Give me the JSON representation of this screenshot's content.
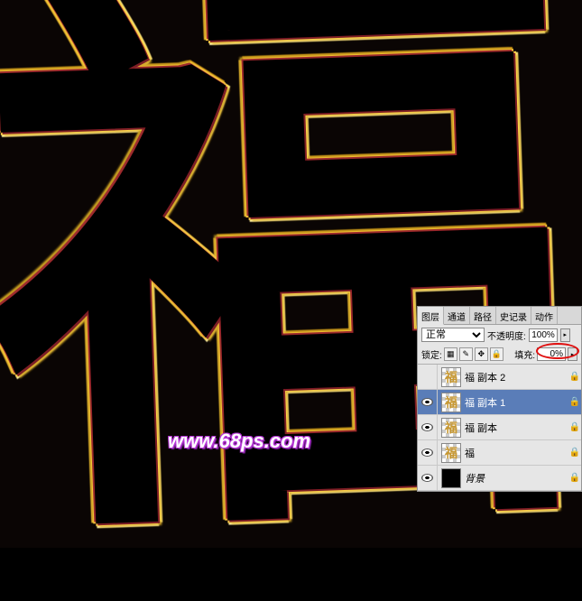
{
  "canvas": {
    "character": "福"
  },
  "watermark": "www.68ps.com",
  "panel": {
    "tabs": {
      "layers": "图层",
      "channels": "通道",
      "paths": "路径",
      "history": "史记录",
      "actions": "动作"
    },
    "blend_mode": "正常",
    "opacity_label": "不透明度:",
    "opacity_value": "100%",
    "lock_label": "锁定:",
    "fill_label": "填充:",
    "fill_value": "0%",
    "layers": [
      {
        "name": "福 副本 2",
        "visible": false,
        "thumb": "福",
        "locked": true
      },
      {
        "name": "福 副本 1",
        "visible": true,
        "thumb": "福",
        "locked": true,
        "selected": true
      },
      {
        "name": "福 副本",
        "visible": true,
        "thumb": "福",
        "locked": true
      },
      {
        "name": "福",
        "visible": true,
        "thumb": "福",
        "locked": true
      },
      {
        "name": "背景",
        "visible": true,
        "thumb": "",
        "locked": true,
        "bg": true
      }
    ]
  }
}
